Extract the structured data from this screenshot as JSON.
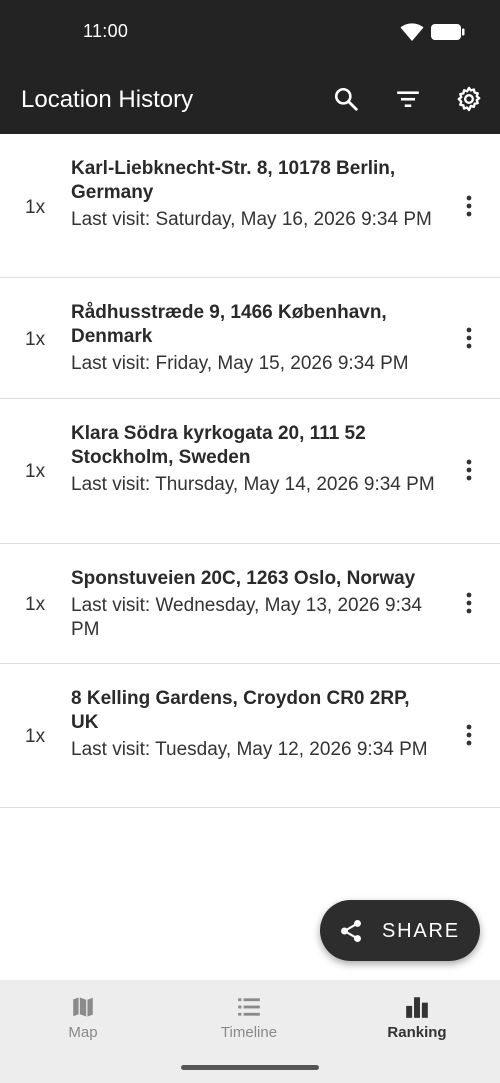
{
  "status_bar": {
    "time": "11:00",
    "wifi_icon": "wifi-icon",
    "battery_icon": "battery-icon"
  },
  "app_bar": {
    "title": "Location History",
    "actions": [
      "search-icon",
      "filter-icon",
      "settings-icon"
    ]
  },
  "locations": [
    {
      "count": "1x",
      "address": "Karl-Liebknecht-Str. 8, 10178 Berlin, Germany",
      "last_visit": "Last visit: Saturday, May 16, 2026 9:34 PM"
    },
    {
      "count": "1x",
      "address": "Rådhusstræde 9, 1466 København, Denmark",
      "last_visit": "Last visit: Friday, May 15, 2026 9:34 PM"
    },
    {
      "count": "1x",
      "address": "Klara Södra kyrkogata 20, 111 52 Stockholm, Sweden",
      "last_visit": "Last visit: Thursday, May 14, 2026 9:34 PM"
    },
    {
      "count": "1x",
      "address": "Sponstuveien 20C, 1263 Oslo, Norway",
      "last_visit": "Last visit: Wednesday, May 13, 2026 9:34 PM"
    },
    {
      "count": "1x",
      "address": "8 Kelling Gardens, Croydon CR0 2RP, UK",
      "last_visit": "Last visit: Tuesday, May 12, 2026 9:34 PM"
    }
  ],
  "share_button": {
    "label": "SHARE",
    "icon": "share-icon"
  },
  "bottom_nav": {
    "items": [
      {
        "label": "Map",
        "icon": "map-icon",
        "active": false
      },
      {
        "label": "Timeline",
        "icon": "timeline-icon",
        "active": false
      },
      {
        "label": "Ranking",
        "icon": "ranking-icon",
        "active": true
      }
    ]
  },
  "colors": {
    "app_bar": "#232323",
    "fab": "#2d2d2d",
    "bottom_nav_bg": "#ededed",
    "nav_inactive": "#8a8a8a",
    "nav_active": "#333333"
  }
}
